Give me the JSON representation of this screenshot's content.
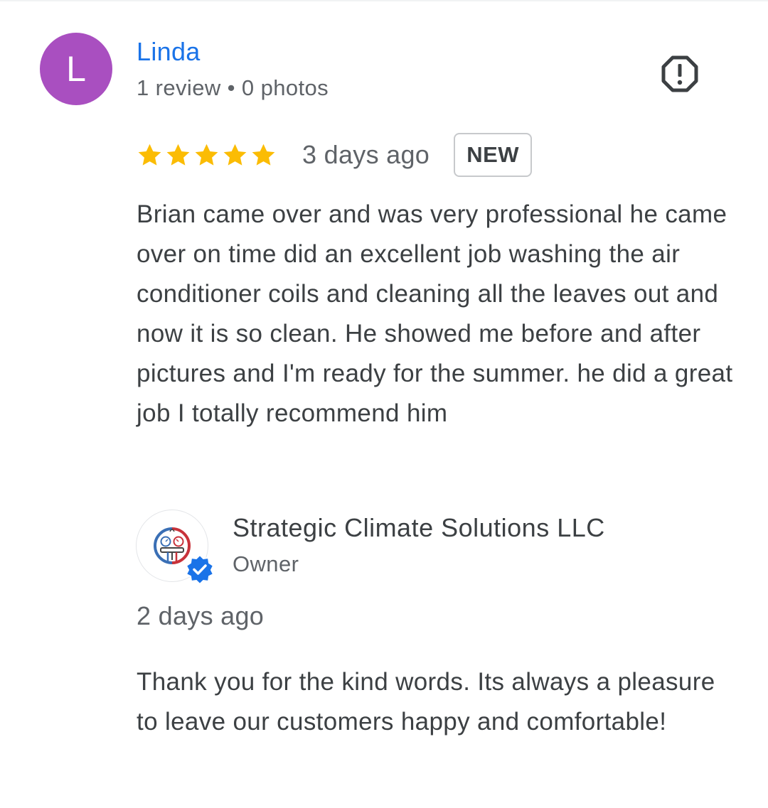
{
  "reviewer": {
    "avatar_letter": "L",
    "avatar_color": "#a94fc0",
    "name": "Linda",
    "meta": "1 review • 0 photos"
  },
  "report_icon": "report-flag-icon",
  "rating": {
    "stars": 5,
    "max_stars": 5,
    "star_color": "#fbbc04",
    "age": "3 days ago",
    "badge": "NEW"
  },
  "review_text": "Brian came over and was very professional he came over on time did an excellent job washing the air conditioner coils and cleaning all the leaves out and now it is so clean. He showed me before and after pictures and I'm ready for the summer. he did a great job I totally recommend him",
  "owner_reply": {
    "logo_icon": "hvac-gauges-logo-icon",
    "verified_icon": "verified-check-icon",
    "name": "Strategic Climate Solutions LLC",
    "role": "Owner",
    "age": "2 days ago",
    "text": "Thank you for the kind words. Its always a pleasure to leave our customers happy and comfortable!"
  },
  "colors": {
    "accent": "#1a73e8",
    "text": "#3c4043",
    "muted": "#5f6368"
  }
}
